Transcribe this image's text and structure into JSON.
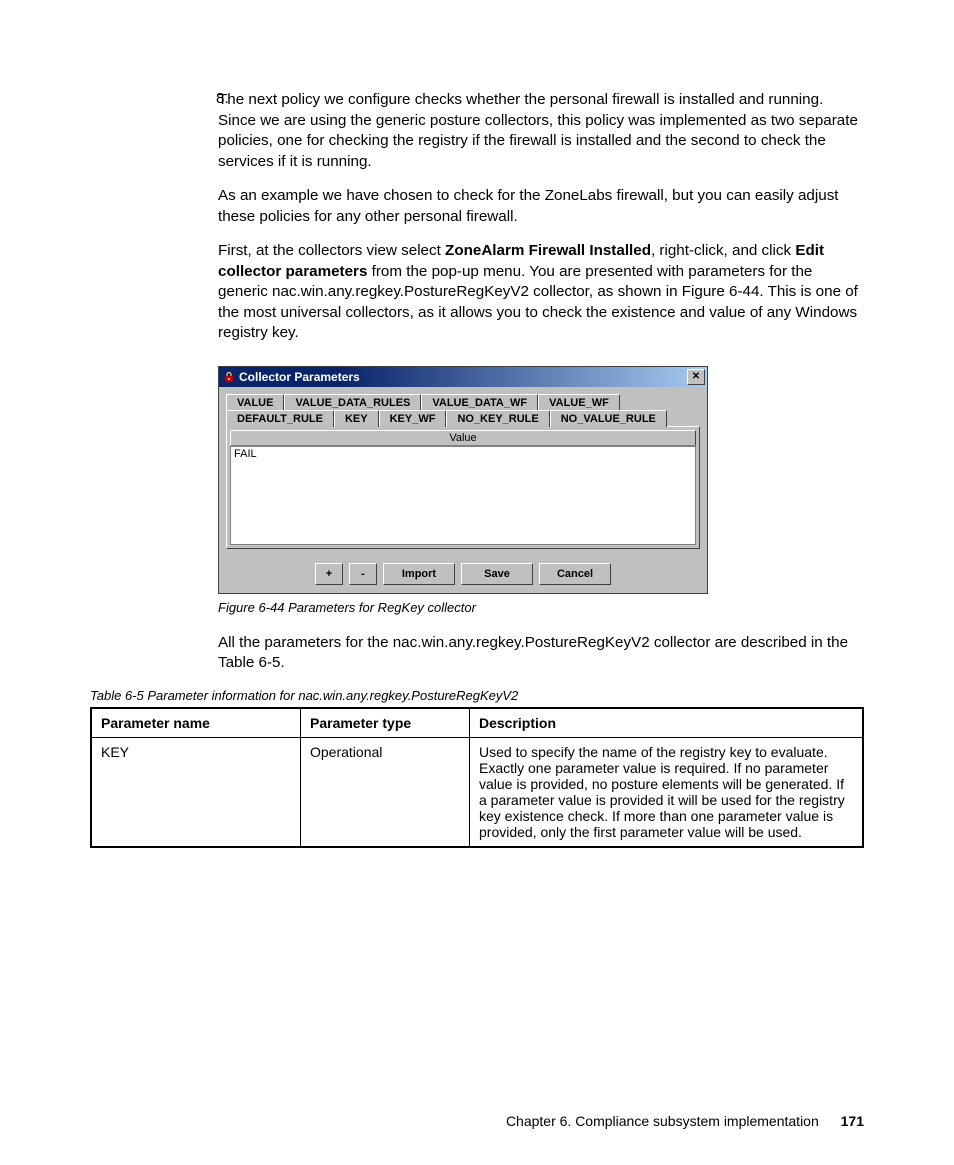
{
  "step": {
    "number": "8.",
    "para1_a": "The next policy we configure checks whether the personal firewall is installed and running. Since we are using the generic posture collectors, this policy was implemented as two separate policies, one for checking the registry if the firewall is installed and the second to check the services if it is running.",
    "para2": "As an example we have chosen to check for the ZoneLabs firewall, but you can easily adjust these policies for any other personal firewall.",
    "para3_a": "First, at the collectors view select ",
    "para3_b1": "ZoneAlarm Firewall Installed",
    "para3_c": ", right-click, and click ",
    "para3_b2": "Edit collector parameters",
    "para3_d": " from the pop-up menu. You are presented with parameters for the generic nac.win.any.regkey.PostureRegKeyV2 collector, as shown in Figure 6-44. This is one of the most universal collectors, as it allows you to check the existence and value of any Windows registry key."
  },
  "dialog": {
    "title": "Collector Parameters",
    "tabs_row1": [
      "VALUE",
      "VALUE_DATA_RULES",
      "VALUE_DATA_WF",
      "VALUE_WF"
    ],
    "tabs_row2": [
      "DEFAULT_RULE",
      "KEY",
      "KEY_WF",
      "NO_KEY_RULE",
      "NO_VALUE_RULE"
    ],
    "active_tab": "DEFAULT_RULE",
    "grid_header": "Value",
    "grid_value": "FAIL",
    "buttons": {
      "add": "+",
      "remove": "-",
      "import": "Import",
      "save": "Save",
      "cancel": "Cancel"
    }
  },
  "figure_caption": "Figure 6-44   Parameters for RegKey collector",
  "after_figure": "All the parameters for the nac.win.any.regkey.PostureRegKeyV2 collector are described in the Table 6-5.",
  "table_caption": "Table 6-5   Parameter information for nac.win.any.regkey.PostureRegKeyV2",
  "table": {
    "headers": [
      "Parameter name",
      "Parameter type",
      "Description"
    ],
    "rows": [
      {
        "name": "KEY",
        "type": "Operational",
        "desc": "Used to specify the name of the registry key to evaluate. Exactly one parameter value is required. If no parameter value is provided, no posture elements will be generated. If a parameter value is provided it will be used for the registry key existence check. If more than one parameter value is provided, only the first parameter value will be used."
      }
    ]
  },
  "footer": {
    "chapter": "Chapter 6. Compliance subsystem implementation",
    "page": "171"
  }
}
